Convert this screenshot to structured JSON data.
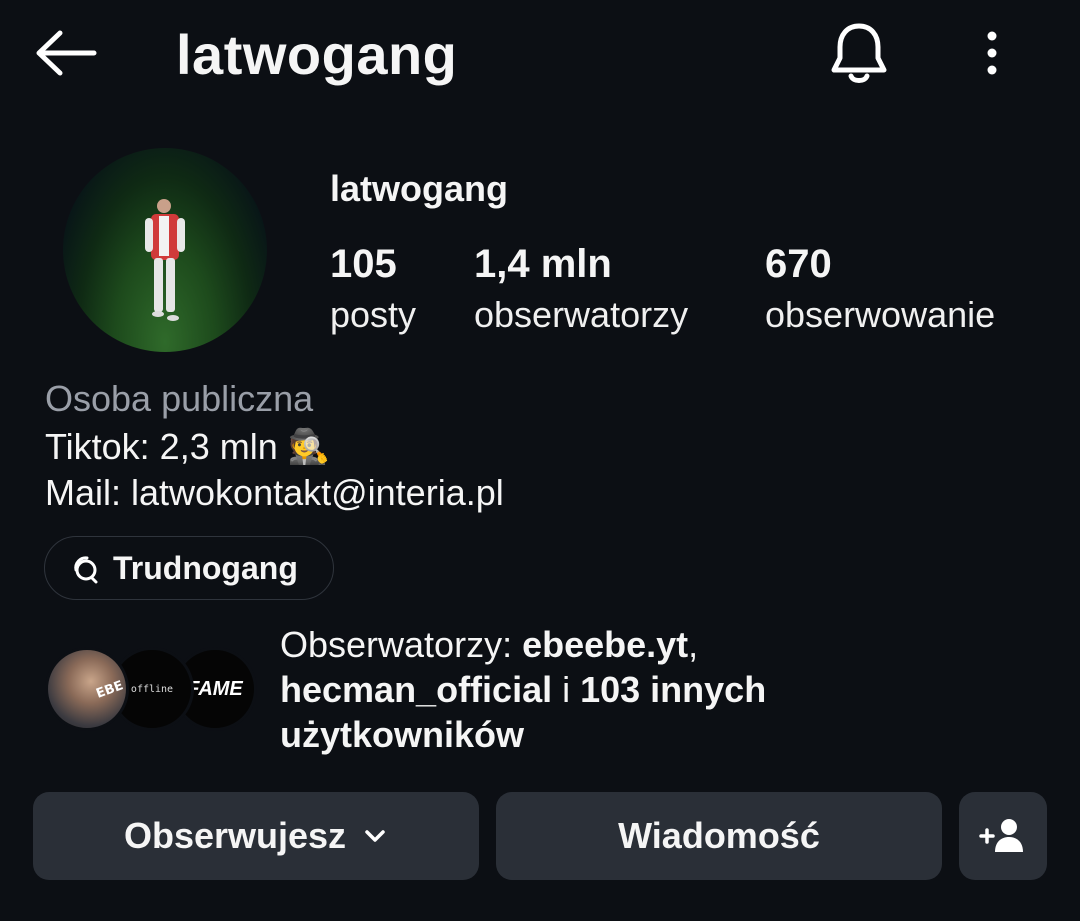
{
  "header": {
    "title": "latwogang"
  },
  "profile": {
    "username": "latwogang",
    "stats": [
      {
        "value": "105",
        "label": "posty"
      },
      {
        "value": "1,4 mln",
        "label": "obserwatorzy"
      },
      {
        "value": "670",
        "label": "obserwowanie"
      }
    ],
    "category": "Osoba publiczna",
    "bio_line1": "Tiktok: 2,3 mln",
    "bio_line1_emoji": "🕵️",
    "bio_line2": "Mail: latwokontakt@interia.pl",
    "threads_label": "Trudnogang"
  },
  "followed_by": {
    "prefix": "Obserwatorzy: ",
    "user1": "ebeebe.yt",
    "sep": ",",
    "user2": "hecman_official",
    "middle": " i ",
    "others": "103 innych użytkowników",
    "avatar_texts": [
      "EBE",
      "offline",
      "FAME"
    ]
  },
  "actions": {
    "follow_label": "Obserwujesz",
    "message_label": "Wiadomość"
  },
  "colors": {
    "background": "#0c0f14",
    "button": "#2a2f37",
    "muted_text": "#9a9fa8"
  }
}
